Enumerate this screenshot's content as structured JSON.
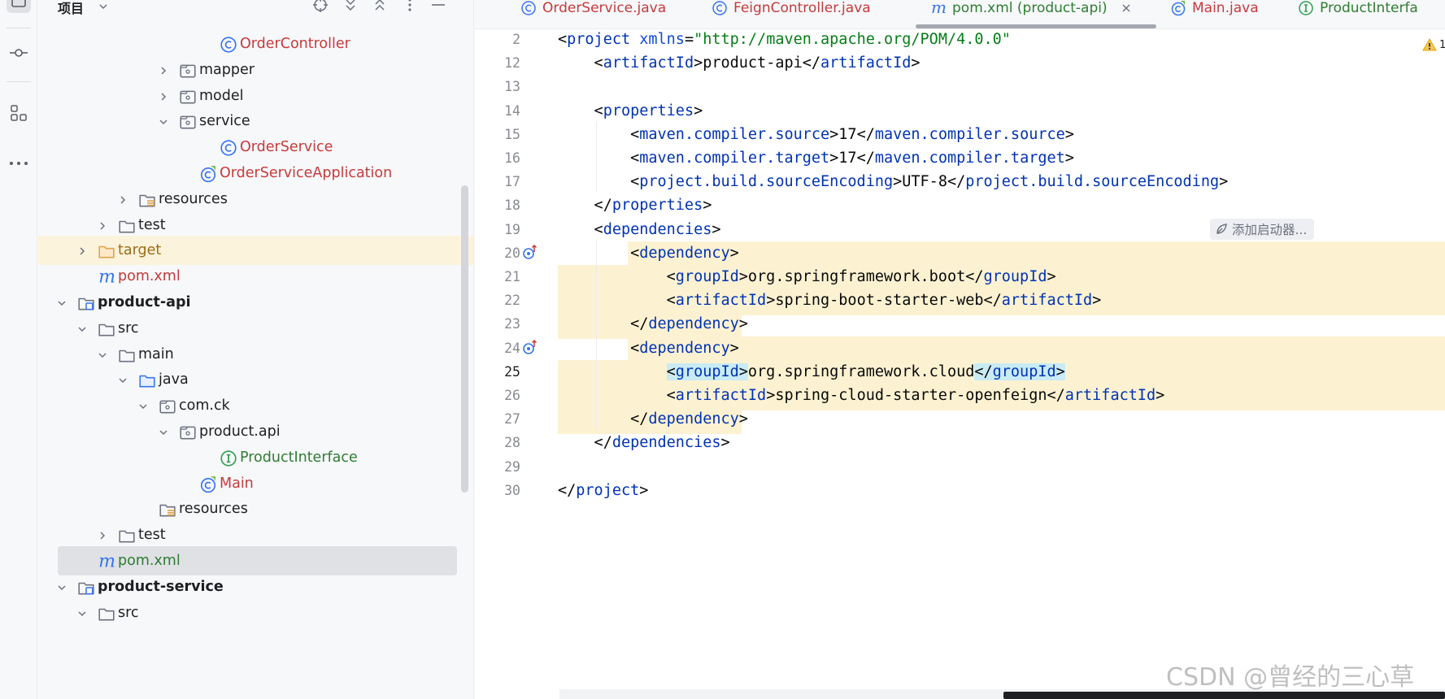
{
  "colors": {
    "accent_blue": "#3574f0",
    "error_red": "#c63a3a",
    "folder_orange": "#e0a34b",
    "interface_green": "#2e7d32",
    "highlight_yellow": "#fcf2d2"
  },
  "project_panel": {
    "title": "项目",
    "header_icons": [
      "crosshair-icon",
      "expand-all-icon",
      "collapse-all-icon",
      "more-vertical-icon",
      "minimize-icon"
    ],
    "tree": [
      {
        "label": "OrderController",
        "icon": "class-icon",
        "expanded": null,
        "color": "red"
      },
      {
        "label": "mapper",
        "icon": "package-icon",
        "expanded": false,
        "color": "normal"
      },
      {
        "label": "model",
        "icon": "package-icon",
        "expanded": false,
        "color": "normal"
      },
      {
        "label": "service",
        "icon": "package-icon",
        "expanded": true,
        "color": "normal"
      },
      {
        "label": "OrderService",
        "icon": "class-icon",
        "expanded": null,
        "color": "red"
      },
      {
        "label": "OrderServiceApplication",
        "icon": "spring-boot-class-icon",
        "expanded": null,
        "color": "red"
      },
      {
        "label": "resources",
        "icon": "resources-folder-icon",
        "expanded": false,
        "color": "normal"
      },
      {
        "label": "test",
        "icon": "folder-icon",
        "expanded": false,
        "color": "normal"
      },
      {
        "label": "target",
        "icon": "excluded-folder-icon",
        "expanded": false,
        "color": "orange"
      },
      {
        "label": "pom.xml",
        "icon": "maven-icon",
        "expanded": null,
        "color": "red"
      },
      {
        "label": "product-api",
        "icon": "module-icon",
        "expanded": true,
        "color": "bold"
      },
      {
        "label": "src",
        "icon": "folder-icon",
        "expanded": true,
        "color": "normal"
      },
      {
        "label": "main",
        "icon": "folder-icon",
        "expanded": true,
        "color": "normal"
      },
      {
        "label": "java",
        "icon": "source-folder-icon",
        "expanded": true,
        "color": "normal"
      },
      {
        "label": "com.ck",
        "icon": "package-icon",
        "expanded": true,
        "color": "normal"
      },
      {
        "label": "product.api",
        "icon": "package-icon",
        "expanded": true,
        "color": "normal"
      },
      {
        "label": "ProductInterface",
        "icon": "interface-icon",
        "expanded": null,
        "color": "green"
      },
      {
        "label": "Main",
        "icon": "spring-boot-class-icon",
        "expanded": null,
        "color": "red"
      },
      {
        "label": "resources",
        "icon": "resources-folder-icon",
        "expanded": null,
        "color": "normal"
      },
      {
        "label": "test",
        "icon": "folder-icon",
        "expanded": false,
        "color": "normal"
      },
      {
        "label": "pom.xml",
        "icon": "maven-icon",
        "expanded": null,
        "color": "green",
        "selected": true
      },
      {
        "label": "product-service",
        "icon": "module-icon",
        "expanded": true,
        "color": "bold"
      },
      {
        "label": "src",
        "icon": "folder-icon",
        "expanded": true,
        "color": "normal"
      }
    ]
  },
  "tabs": [
    {
      "label": "OrderService.java",
      "icon": "class-icon",
      "color": "red",
      "active": false
    },
    {
      "label": "FeignController.java",
      "icon": "class-icon",
      "color": "red",
      "active": false
    },
    {
      "label": "pom.xml (product-api)",
      "icon": "maven-icon",
      "color": "green",
      "active": true,
      "close_icon": "close-icon"
    },
    {
      "label": "Main.java",
      "icon": "spring-boot-class-icon",
      "color": "red",
      "active": false
    },
    {
      "label": "ProductInterfa",
      "icon": "interface-icon",
      "color": "green",
      "active": false
    }
  ],
  "editor": {
    "warning_count": "1",
    "inlay_hint": "添加启动器...",
    "current_line": "25",
    "lines": [
      {
        "n": "2",
        "text": "<project xmlns=\"http://maven.apache.org/POM/4.0.0\""
      },
      {
        "n": "12",
        "text": "    <artifactId>product-api</artifactId>"
      },
      {
        "n": "13",
        "text": ""
      },
      {
        "n": "14",
        "text": "    <properties>"
      },
      {
        "n": "15",
        "text": "        <maven.compiler.source>17</maven.compiler.source>"
      },
      {
        "n": "16",
        "text": "        <maven.compiler.target>17</maven.compiler.target>"
      },
      {
        "n": "17",
        "text": "        <project.build.sourceEncoding>UTF-8</project.build.sourceEncoding>"
      },
      {
        "n": "18",
        "text": "    </properties>"
      },
      {
        "n": "19",
        "text": "    <dependencies>"
      },
      {
        "n": "20",
        "text": "        <dependency>"
      },
      {
        "n": "21",
        "text": "            <groupId>org.springframework.boot</groupId>"
      },
      {
        "n": "22",
        "text": "            <artifactId>spring-boot-starter-web</artifactId>"
      },
      {
        "n": "23",
        "text": "        </dependency>"
      },
      {
        "n": "24",
        "text": "        <dependency>"
      },
      {
        "n": "25",
        "text": "            <groupId>org.springframework.cloud</groupId>"
      },
      {
        "n": "26",
        "text": "            <artifactId>spring-cloud-starter-openfeign</artifactId>"
      },
      {
        "n": "27",
        "text": "        </dependency>"
      },
      {
        "n": "28",
        "text": "    </dependencies>"
      },
      {
        "n": "29",
        "text": ""
      },
      {
        "n": "30",
        "text": "</project>"
      }
    ]
  },
  "watermark": "CSDN @曾经的三心草"
}
